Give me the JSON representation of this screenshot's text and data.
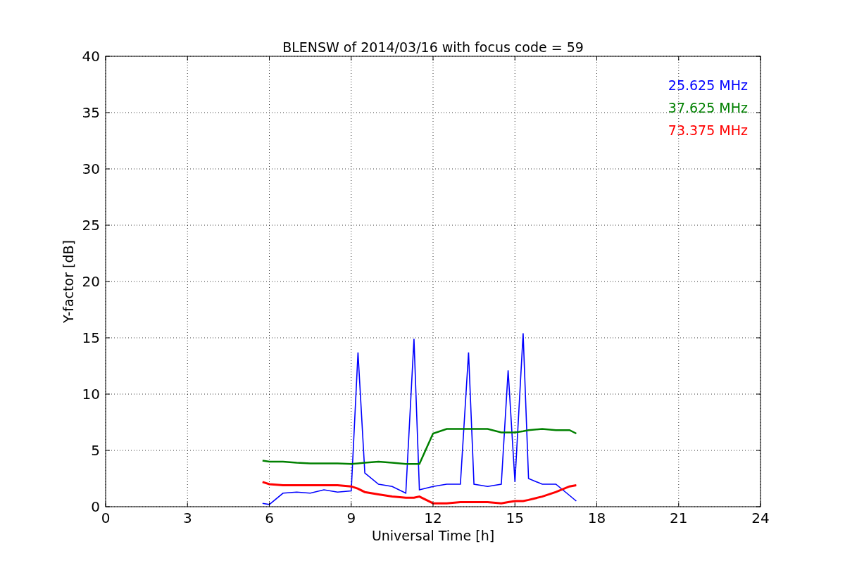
{
  "figure": {
    "chart_data": {
      "type": "line",
      "title": "BLENSW of 2014/03/16 with focus code = 59",
      "xlabel": "Universal Time [h]",
      "ylabel": "Y-factor [dB]",
      "x": [
        5.75,
        6.0,
        6.5,
        7.0,
        7.5,
        8.0,
        8.5,
        9.0,
        9.25,
        9.5,
        10.0,
        10.5,
        11.0,
        11.3,
        11.5,
        12.0,
        12.5,
        13.0,
        13.3,
        13.5,
        14.0,
        14.5,
        14.75,
        15.0,
        15.3,
        15.5,
        16.0,
        16.5,
        17.0,
        17.25
      ],
      "series": [
        {
          "name": "25.625 MHz",
          "color": "#0000ff",
          "values": [
            0.3,
            0.2,
            1.2,
            1.3,
            1.2,
            1.5,
            1.3,
            1.4,
            13.7,
            3,
            2,
            1.8,
            1.2,
            14.9,
            1.5,
            1.8,
            2,
            2,
            13.7,
            2,
            1.8,
            2,
            12.1,
            2.2,
            15.4,
            2.5,
            2,
            2,
            1,
            0.5
          ]
        },
        {
          "name": "37.625 MHz",
          "color": "#008000",
          "values": [
            4.1,
            4.0,
            4.0,
            3.9,
            3.85,
            3.85,
            3.85,
            3.8,
            3.85,
            3.9,
            4.0,
            3.9,
            3.8,
            3.8,
            3.8,
            6.5,
            6.9,
            6.9,
            6.9,
            6.9,
            6.9,
            6.6,
            6.6,
            6.6,
            6.7,
            6.8,
            6.9,
            6.8,
            6.8,
            6.5
          ]
        },
        {
          "name": "73.375 MHz",
          "color": "#ff0000",
          "values": [
            2.2,
            2.0,
            1.9,
            1.9,
            1.9,
            1.9,
            1.9,
            1.8,
            1.6,
            1.3,
            1.1,
            0.9,
            0.8,
            0.8,
            0.9,
            0.3,
            0.3,
            0.4,
            0.4,
            0.4,
            0.4,
            0.3,
            0.4,
            0.5,
            0.5,
            0.6,
            0.9,
            1.3,
            1.8,
            1.9
          ]
        }
      ],
      "xlim": [
        0,
        24
      ],
      "ylim": [
        0,
        40
      ],
      "xticks": [
        0,
        3,
        6,
        9,
        12,
        15,
        18,
        21,
        24
      ],
      "yticks": [
        0,
        5,
        10,
        15,
        20,
        25,
        30,
        35,
        40
      ],
      "grid": true
    }
  }
}
